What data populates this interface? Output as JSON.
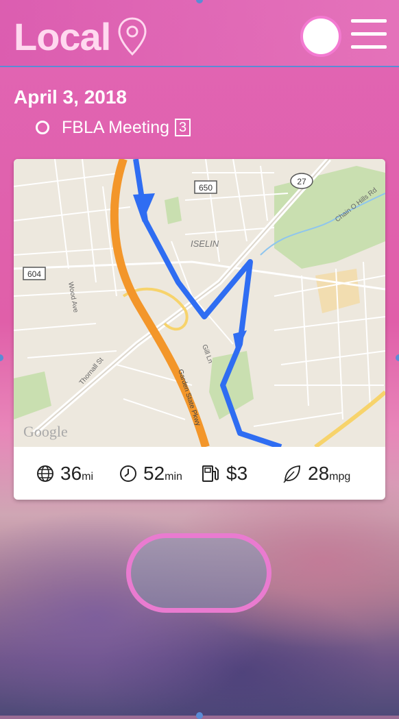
{
  "header": {
    "title": "Local",
    "icons": [
      "location-pin-icon",
      "avatar",
      "hamburger-menu-icon"
    ]
  },
  "agenda": {
    "date": "April 3, 2018",
    "event": {
      "label": "FBLA Meeting",
      "badge": "3"
    }
  },
  "map": {
    "labels": {
      "road_650": "650",
      "road_27": "27",
      "road_604": "604",
      "iselin": "ISELIN",
      "wood_ave": "Wood Ave",
      "thornall_st": "Thornall St",
      "gill_ln": "Gill Ln",
      "parkway": "Garden State Pkwy",
      "chain_o_hills": "Chain O Hills Rd",
      "watermark": "Google"
    },
    "route_color": "#2f6df2",
    "highway_color": "#f3962a"
  },
  "stats": {
    "distance": {
      "value": "36",
      "unit": "mi",
      "icon": "globe-icon"
    },
    "time": {
      "value": "52",
      "unit": "min",
      "icon": "clock-icon"
    },
    "cost": {
      "value": "$3",
      "unit": "",
      "icon": "fuel-pump-icon"
    },
    "efficiency": {
      "value": "28",
      "unit": "mpg",
      "icon": "leaf-icon"
    }
  },
  "colors": {
    "accent_pink": "#e97bd0",
    "header_text": "#ffd8ef",
    "selection_blue": "#5a8cd6"
  }
}
